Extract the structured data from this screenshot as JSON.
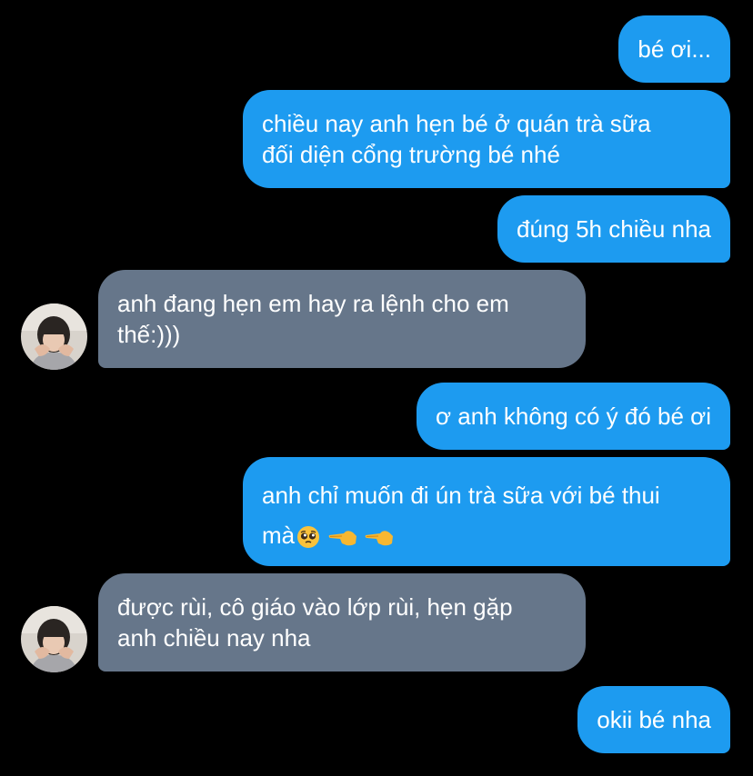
{
  "messages": [
    {
      "side": "out",
      "lines": [
        "bé ơi..."
      ]
    },
    {
      "side": "out",
      "lines": [
        "chiều nay anh hẹn bé ở quán trà sữa",
        "đối diện cổng trường bé nhé"
      ]
    },
    {
      "side": "out",
      "lines": [
        "đúng 5h chiều nha"
      ]
    },
    {
      "side": "in",
      "lines": [
        "anh đang hẹn em hay ra lệnh cho em",
        "thế:)))"
      ]
    },
    {
      "side": "out",
      "lines": [
        "ơ anh không có ý đó bé ơi"
      ]
    },
    {
      "side": "out",
      "lines": [
        "anh chỉ muốn đi ún trà sữa với bé thui",
        "mà"
      ],
      "emojis": [
        "pleading-face-icon",
        "pointing-left-icon",
        "pointing-left-icon"
      ]
    },
    {
      "side": "in",
      "lines": [
        "được rùi, cô giáo vào lớp rùi, hẹn gặp",
        "anh chiều nay nha"
      ]
    },
    {
      "side": "out",
      "lines": [
        "okii bé nha"
      ]
    }
  ],
  "colors": {
    "background": "#000000",
    "outgoing_bubble": "#1d9bf0",
    "incoming_bubble": "#66768a",
    "text": "#ffffff"
  },
  "avatar_icon": "contact-avatar-photo"
}
